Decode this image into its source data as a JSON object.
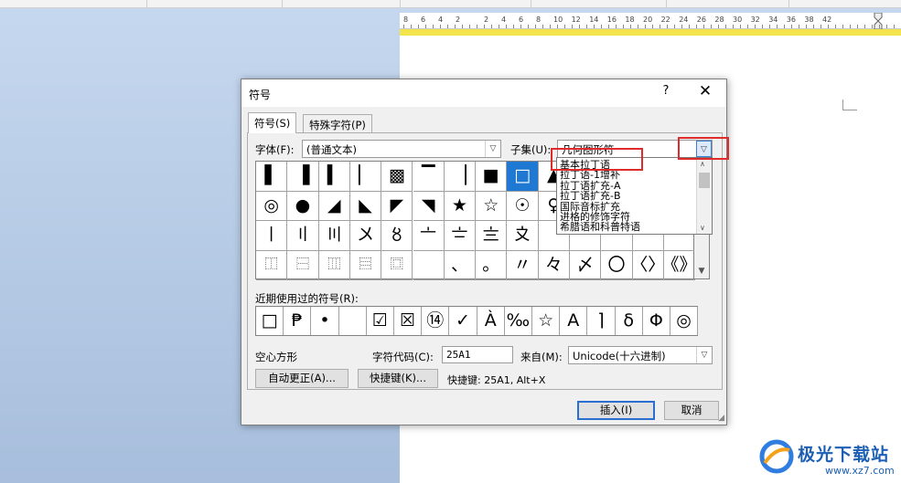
{
  "ruler": {
    "labels": [
      "8",
      "6",
      "4",
      "2",
      "2",
      "4",
      "6",
      "8",
      "10",
      "12",
      "14",
      "16",
      "18",
      "20",
      "22",
      "24",
      "26",
      "28",
      "30",
      "32",
      "34",
      "36",
      "38",
      "42"
    ]
  },
  "dialog": {
    "title": "符号",
    "help": "?",
    "close": "✕",
    "tabs": [
      "符号(S)",
      "特殊字符(P)"
    ],
    "font_label": "字体(F):",
    "font_value": "(普通文本)",
    "subset_label": "子集(U):",
    "subset_value": "几何图形符",
    "symbols": [
      [
        "▌",
        "▐",
        "▍",
        "▏",
        "▩",
        "▔",
        "▕",
        "■",
        "□",
        "▲",
        "△",
        "",
        "",
        ""
      ],
      [
        "◎",
        "●",
        "◢",
        "◣",
        "◤",
        "◥",
        "★",
        "☆",
        "☉",
        "♀",
        "♂",
        "",
        "",
        ""
      ],
      [
        "〡",
        "〢",
        "〣",
        "〤",
        "〥",
        "〦",
        "〧",
        "〨",
        "〩",
        "",
        "",
        "",
        "",
        ""
      ],
      [
        "⿰",
        "⿱",
        "⿲",
        "⿳",
        "⿴",
        "",
        "、",
        "。",
        "〃",
        "々",
        "〆",
        "〇",
        "〈〉",
        "《》"
      ]
    ],
    "recent_label": "近期使用过的符号(R):",
    "recent": [
      "□",
      "₱",
      "•",
      "",
      "☑",
      "☒",
      "⑭",
      "✓",
      "À",
      "‰",
      "☆",
      "A",
      "⌉",
      "δ",
      "Φ",
      "◎"
    ],
    "char_name": "空心方形",
    "char_code_label": "字符代码(C):",
    "char_code_value": "25A1",
    "from_label": "来自(M):",
    "from_value": "Unicode(十六进制)",
    "autocorrect_button": "自动更正(A)...",
    "shortcut_button": "快捷键(K)...",
    "shortcut_text": "快捷键: 25A1, Alt+X",
    "insert_button": "插入(I)",
    "cancel_button": "取消"
  },
  "subset_options": [
    "基本拉丁语",
    "拉丁语-1增补",
    "拉丁语扩充-A",
    "拉丁语扩充-B",
    "国际音标扩充",
    "进格的修饰字符",
    "希腊语和科普特语"
  ],
  "watermark": {
    "name": "极光下载站",
    "url": "www.xz7.com"
  },
  "colors": {
    "selection": "#1f78d1",
    "highlight": "#e02b2b",
    "ruler_band": "#f2e44a"
  }
}
